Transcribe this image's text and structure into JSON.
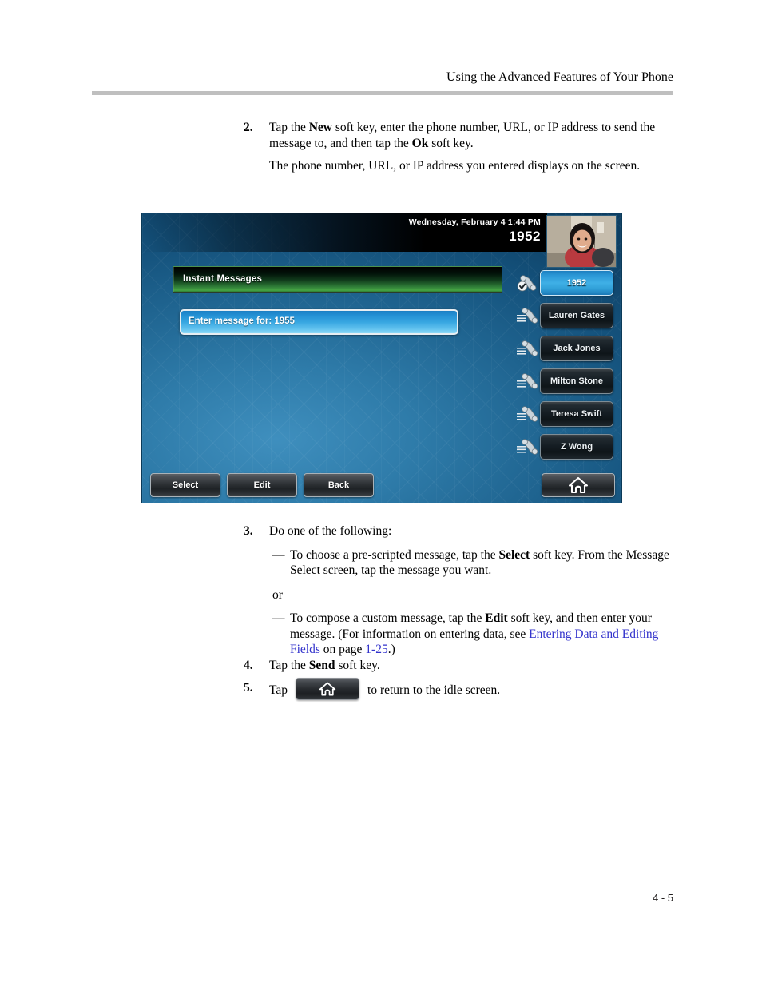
{
  "page": {
    "header_title": "Using the Advanced Features of Your Phone",
    "footer_page_number": "4 - 5"
  },
  "steps": {
    "step2": {
      "number": "2.",
      "line1_a": "Tap the ",
      "line1_new": "New",
      "line1_b": " soft key, enter the phone number, URL, or IP address to send the message to, and then tap the ",
      "line1_ok": "Ok",
      "line1_c": " soft key.",
      "line2": "The phone number, URL, or IP address you entered displays on the screen."
    },
    "step3": {
      "number": "3.",
      "lead": "Do one of the following:",
      "bullet1_a": "To choose a pre-scripted message, tap the ",
      "bullet1_select": "Select",
      "bullet1_b": " soft key. From the Message Select screen, tap the message you want.",
      "or": "or",
      "bullet2_a": "To compose a custom message, tap the ",
      "bullet2_edit": "Edit",
      "bullet2_b": " soft key, and then enter your message. (For information on entering data, see ",
      "bullet2_link": "Entering Data and Editing Fields",
      "bullet2_c": " on page ",
      "bullet2_page": "1-25",
      "bullet2_d": ".)",
      "dash": "—"
    },
    "step4": {
      "number": "4.",
      "text_a": "Tap the ",
      "text_send": "Send",
      "text_b": " soft key."
    },
    "step5": {
      "number": "5.",
      "text_a": "Tap",
      "text_b": "to return to the idle screen.",
      "home_icon": "home-icon"
    }
  },
  "phone_screen": {
    "status_bar": {
      "date_time": "Wednesday, February 4  1:44 PM",
      "extension": "1952"
    },
    "avatar": {
      "icon": "user-photo-avatar"
    },
    "title_bar": {
      "title": "Instant Messages"
    },
    "message_field": {
      "value": "Enter message for: 1955"
    },
    "line_keys": [
      {
        "label": "1952",
        "icon": "handset-registered-check-icon",
        "active": true
      },
      {
        "label": "Lauren Gates",
        "icon": "handset-line-icon",
        "active": false
      },
      {
        "label": "Jack Jones",
        "icon": "handset-line-icon",
        "active": false
      },
      {
        "label": "Milton Stone",
        "icon": "handset-line-icon",
        "active": false
      },
      {
        "label": "Teresa Swift",
        "icon": "handset-line-icon",
        "active": false
      },
      {
        "label": "Z Wong",
        "icon": "handset-line-icon",
        "active": false
      }
    ],
    "soft_keys": [
      {
        "label": "Select"
      },
      {
        "label": "Edit"
      },
      {
        "label": "Back"
      }
    ],
    "home_key": {
      "icon": "home-icon"
    },
    "colors": {
      "screen_blue": "#2e7ba9",
      "title_green": "#46a544",
      "active_key_blue": "#3fb0e6",
      "link_blue": "#3333cc",
      "rule_gray": "#bfbfbf"
    }
  }
}
